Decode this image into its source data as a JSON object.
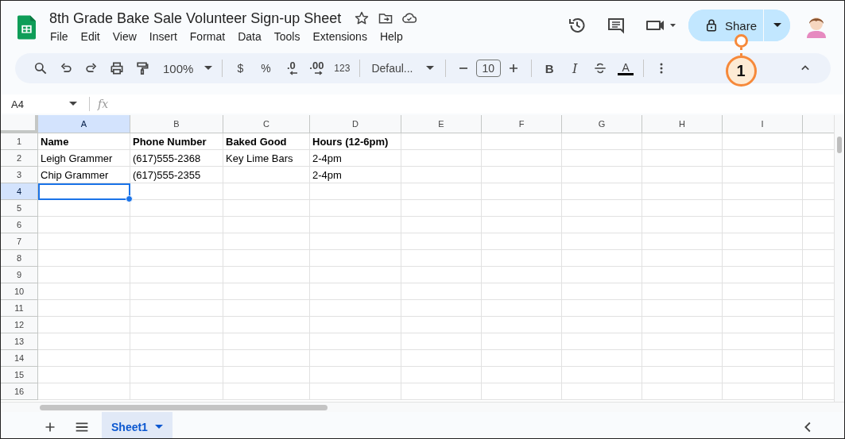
{
  "document": {
    "title": "8th Grade Bake Sale Volunteer Sign-up Sheet"
  },
  "menu": [
    "File",
    "Edit",
    "View",
    "Insert",
    "Format",
    "Data",
    "Tools",
    "Extensions",
    "Help"
  ],
  "share_button": {
    "label": "Share"
  },
  "callout": {
    "label": "1"
  },
  "toolbar": {
    "zoom": "100%",
    "currency": "$",
    "percent": "%",
    "decrease_decimal": ".0",
    "increase_decimal": ".00",
    "number_format": "123",
    "font": "Defaul...",
    "font_size": "10",
    "bold": "B",
    "italic": "I",
    "text_color": "A"
  },
  "name_box": {
    "value": "A4"
  },
  "formula_bar": {
    "label": "fx"
  },
  "columns": [
    {
      "label": "A",
      "selected": true
    },
    {
      "label": "B",
      "selected": false
    },
    {
      "label": "C",
      "selected": false
    },
    {
      "label": "D",
      "selected": false
    },
    {
      "label": "E",
      "selected": false
    },
    {
      "label": "F",
      "selected": false
    },
    {
      "label": "G",
      "selected": false
    },
    {
      "label": "H",
      "selected": false
    },
    {
      "label": "I",
      "selected": false
    }
  ],
  "rows": [
    {
      "label": "1",
      "selected": false,
      "cells": [
        {
          "text": "Name",
          "bold": true,
          "selected": false
        },
        {
          "text": "Phone Number",
          "bold": true,
          "selected": false
        },
        {
          "text": "Baked Good",
          "bold": true,
          "selected": false
        },
        {
          "text": "Hours (12-6pm)",
          "bold": true,
          "selected": false
        }
      ]
    },
    {
      "label": "2",
      "selected": false,
      "cells": [
        {
          "text": "Leigh Grammer",
          "bold": false,
          "selected": false
        },
        {
          "text": "(617)555-2368",
          "bold": false,
          "selected": false
        },
        {
          "text": "Key Lime Bars",
          "bold": false,
          "selected": false
        },
        {
          "text": "2-4pm",
          "bold": false,
          "selected": false
        }
      ]
    },
    {
      "label": "3",
      "selected": false,
      "cells": [
        {
          "text": "Chip Grammer",
          "bold": false,
          "selected": false
        },
        {
          "text": "(617)555-2355",
          "bold": false,
          "selected": false
        },
        {
          "selected": false
        },
        {
          "text": "2-4pm",
          "bold": false,
          "selected": false
        }
      ]
    },
    {
      "label": "4",
      "selected": true,
      "cells": [
        {
          "selected": true
        }
      ]
    },
    {
      "label": "5",
      "selected": false
    },
    {
      "label": "6",
      "selected": false
    },
    {
      "label": "7",
      "selected": false
    },
    {
      "label": "8",
      "selected": false
    },
    {
      "label": "9",
      "selected": false
    },
    {
      "label": "10",
      "selected": false
    },
    {
      "label": "11",
      "selected": false
    },
    {
      "label": "12",
      "selected": false
    },
    {
      "label": "13",
      "selected": false
    },
    {
      "label": "14",
      "selected": false
    },
    {
      "label": "15",
      "selected": false
    },
    {
      "label": "16",
      "selected": false
    }
  ],
  "sheets": [
    {
      "label": "Sheet1",
      "selected": true
    }
  ]
}
